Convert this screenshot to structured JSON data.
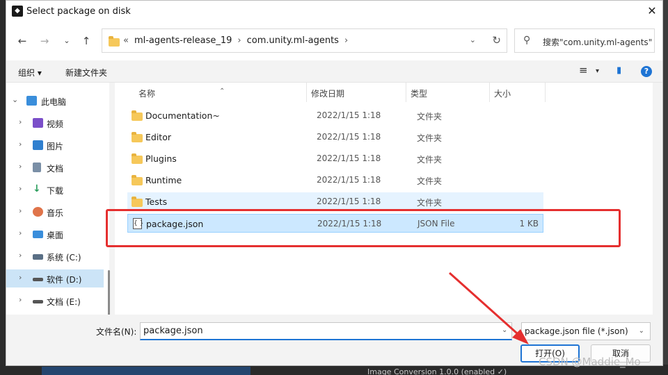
{
  "window": {
    "title": "Select package on disk",
    "app_icon": "unity-icon",
    "close": "✕"
  },
  "nav": {
    "back": "←",
    "forward": "→",
    "history": "⌄",
    "up": "↑"
  },
  "address": {
    "overflow": "«",
    "crumbs": [
      "ml-agents-release_19",
      "com.unity.ml-agents"
    ],
    "separator": "›",
    "dropdown": "⌄",
    "refresh": "↻"
  },
  "search": {
    "icon": "⚲",
    "placeholder": "搜索\"com.unity.ml-agents\""
  },
  "toolbar": {
    "organize": "组织 ▾",
    "new_folder": "新建文件夹",
    "view_icon": "≡",
    "view_drop": "▾",
    "preview_icon": "▮",
    "help": "?"
  },
  "sidebar": {
    "items": [
      {
        "label": "此电脑",
        "chev": "⌄",
        "icon_color": "#3a8edb"
      },
      {
        "label": "视频",
        "chev": "›",
        "icon_color": "#7b4fc9"
      },
      {
        "label": "图片",
        "chev": "›",
        "icon_color": "#2f7fcf"
      },
      {
        "label": "文档",
        "chev": "›",
        "icon_color": "#7a8fa6"
      },
      {
        "label": "下载",
        "chev": "›",
        "icon_color": "#2a9d5c"
      },
      {
        "label": "音乐",
        "chev": "›",
        "icon_color": "#e0744a"
      },
      {
        "label": "桌面",
        "chev": "›",
        "icon_color": "#3a8edb"
      },
      {
        "label": "系统 (C:)",
        "chev": "›",
        "icon_color": "#5a6f85"
      },
      {
        "label": "软件 (D:)",
        "chev": "›",
        "icon_color": "#555555"
      },
      {
        "label": "文档 (E:)",
        "chev": "›",
        "icon_color": "#555555"
      }
    ]
  },
  "columns": {
    "name": "名称",
    "date": "修改日期",
    "type": "类型",
    "size": "大小",
    "sort": "⌃"
  },
  "files": [
    {
      "name": "Documentation~",
      "date": "2022/1/15 1:18",
      "type": "文件夹",
      "size": "",
      "kind": "folder"
    },
    {
      "name": "Editor",
      "date": "2022/1/15 1:18",
      "type": "文件夹",
      "size": "",
      "kind": "folder"
    },
    {
      "name": "Plugins",
      "date": "2022/1/15 1:18",
      "type": "文件夹",
      "size": "",
      "kind": "folder"
    },
    {
      "name": "Runtime",
      "date": "2022/1/15 1:18",
      "type": "文件夹",
      "size": "",
      "kind": "folder"
    },
    {
      "name": "Tests",
      "date": "2022/1/15 1:18",
      "type": "文件夹",
      "size": "",
      "kind": "folder"
    },
    {
      "name": "package.json",
      "date": "2022/1/15 1:18",
      "type": "JSON File",
      "size": "1 KB",
      "kind": "file"
    }
  ],
  "footer": {
    "filename_label": "文件名(N):",
    "filename_value": "package.json",
    "filter": "package.json file (*.json)",
    "open": "打开(O)",
    "cancel": "取消"
  },
  "background": {
    "text": "Image Conversion      1.0.0    (enabled ✓)"
  },
  "watermark": "CSDN @Maddie_Mo",
  "colors": {
    "accent": "#1e74d4",
    "annotation": "#e52f2f",
    "selection": "#cce8ff"
  }
}
